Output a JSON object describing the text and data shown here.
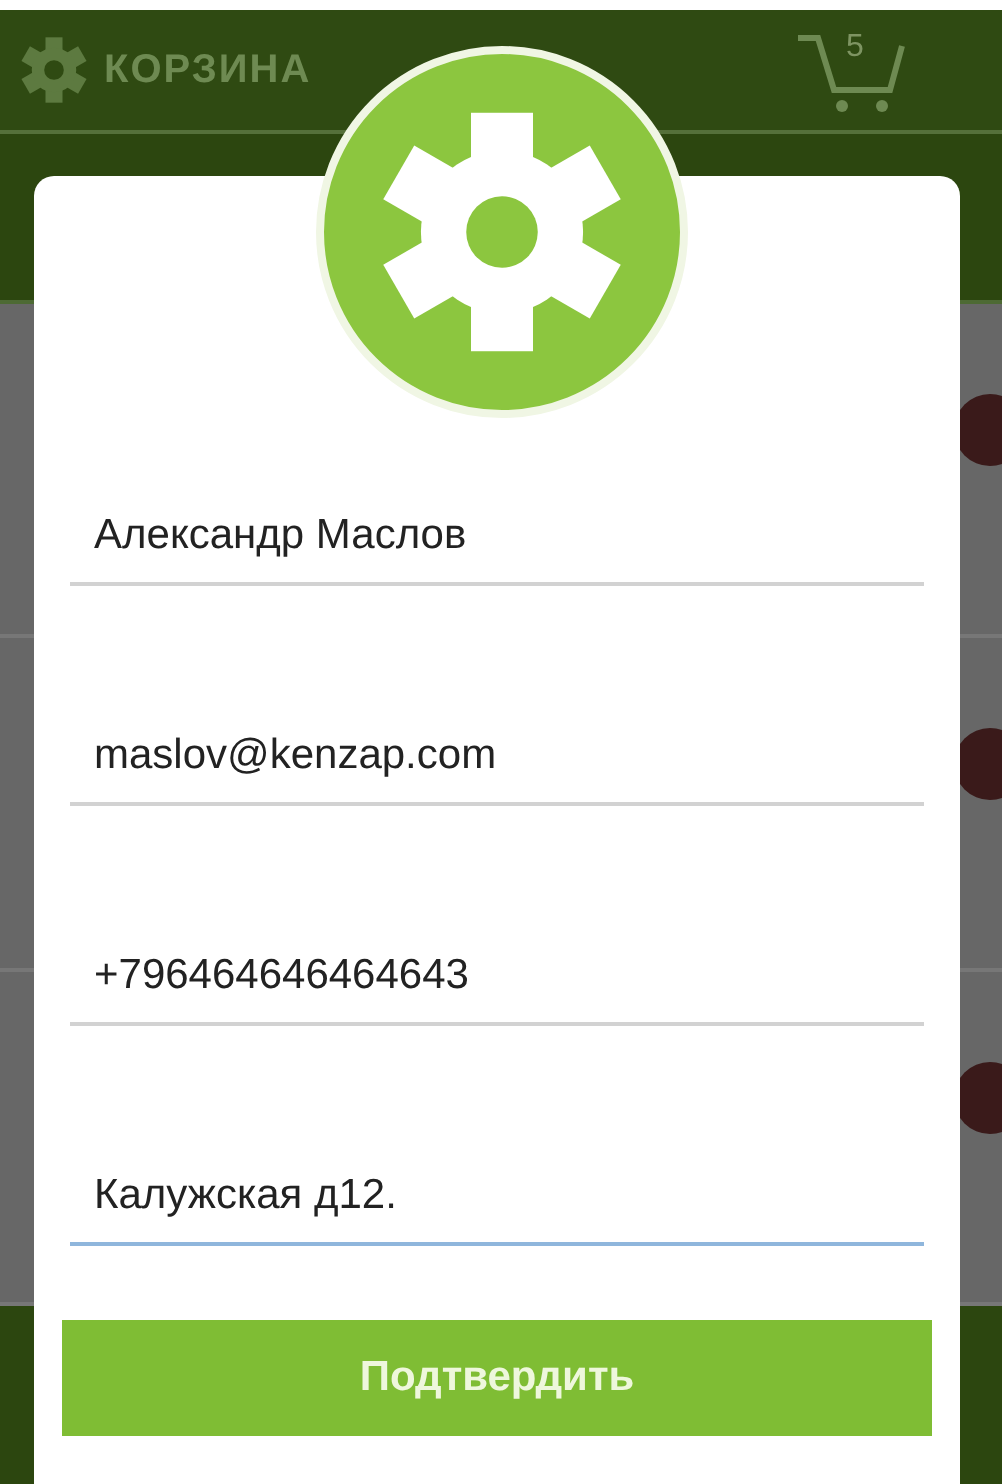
{
  "header": {
    "title": "КОРЗИНА",
    "cart_count": "5"
  },
  "dialog": {
    "fields": [
      {
        "value": "Александр Маслов",
        "focused": false
      },
      {
        "value": "maslov@kenzap.com",
        "focused": false
      },
      {
        "value": "+796464646464643",
        "focused": false
      },
      {
        "value": "Калужская д12.",
        "focused": true
      }
    ],
    "button": "Подтвердить"
  }
}
